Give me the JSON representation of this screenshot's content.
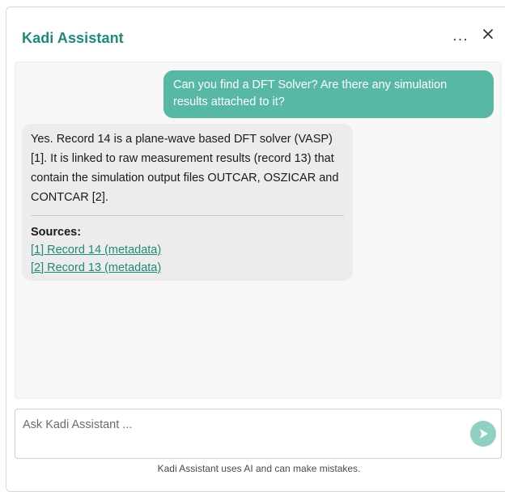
{
  "header": {
    "title": "Kadi Assistant",
    "menu_glyph": "...",
    "menu_icon": "more-horizontal-icon",
    "close_icon": "close-icon"
  },
  "messages": {
    "user": {
      "text": "Can you find a DFT Solver? Are there any simulation results attached to it?"
    },
    "assistant": {
      "text": "Yes. Record 14 is a plane-wave based DFT solver (VASP) [1]. It is linked to raw measurement results (record 13) that contain the simulation output files OUTCAR, OSZICAR and CONTCAR [2].",
      "sources_label": "Sources:",
      "sources": [
        "[1] Record 14 (metadata)",
        "[2] Record 13 (metadata)"
      ]
    }
  },
  "composer": {
    "placeholder": "Ask Kadi Assistant ...",
    "value": "",
    "send_icon": "send-icon"
  },
  "footer": {
    "disclaimer": "Kadi Assistant uses AI and can make mistakes."
  },
  "colors": {
    "accent": "#1f8a78",
    "user_bubble": "#58b8a6",
    "assistant_bubble": "#ececec",
    "send_button": "#8fd0c3"
  }
}
